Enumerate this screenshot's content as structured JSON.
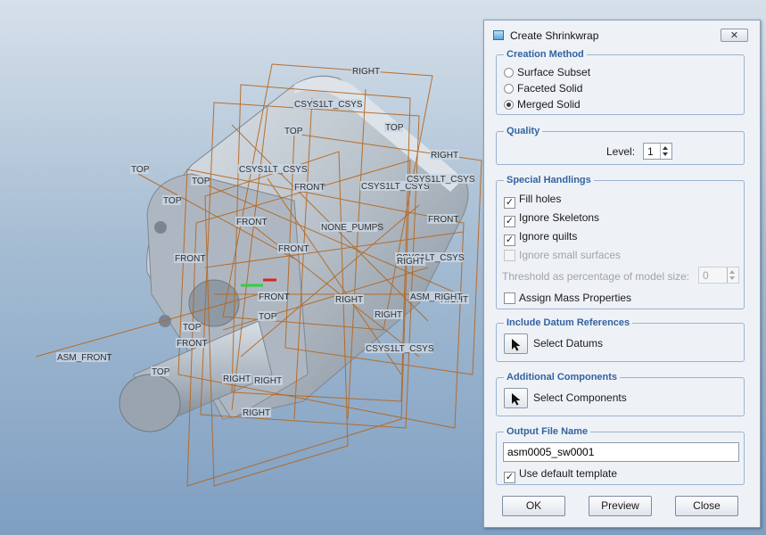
{
  "viewport": {
    "labels": [
      "RIGHT",
      "TOP",
      "TOP",
      "TOP",
      "FRONT",
      "FRONT",
      "ASM_FRONT",
      "TOP",
      "RIGHT",
      "RIGHT",
      "RIGHT",
      "RIGHT",
      "RIGHT",
      "TOP",
      "CSYS1LT_CSYS",
      "CSYS1LT_CSYS",
      "CSYS1LT_CSYS",
      "CSYS1LT_CSYS",
      "CSYS1LT_CSYS",
      "FRONT",
      "FRONT",
      "FRONT",
      "NONE_PUMPS",
      "ASM_RIGHT",
      "TOP",
      "RIGHT",
      "TOP",
      "CSYS1LT_CSYS",
      "RIGHT",
      "FRONT",
      "FRONT",
      "TOP",
      "RIGHT"
    ]
  },
  "dialog": {
    "title": "Create Shrinkwrap",
    "close_glyph": "✕",
    "creation_method": {
      "title": "Creation Method",
      "options": [
        "Surface Subset",
        "Faceted Solid",
        "Merged Solid"
      ],
      "selected": "Merged Solid"
    },
    "quality": {
      "title": "Quality",
      "level_label": "Level:",
      "level_value": "1"
    },
    "special_handlings": {
      "title": "Special Handlings",
      "fill_holes": "Fill holes",
      "ignore_skeletons": "Ignore Skeletons",
      "ignore_quilts": "Ignore quilts",
      "ignore_small_surfaces": "Ignore small surfaces",
      "threshold_label": "Threshold as percentage of model size:",
      "threshold_value": "0",
      "assign_mass": "Assign Mass Properties",
      "check_mark": "✓"
    },
    "datum_refs": {
      "title": "Include Datum References",
      "button_label": "Select Datums"
    },
    "components": {
      "title": "Additional Components",
      "button_label": "Select Components"
    },
    "output": {
      "title": "Output File Name",
      "file_name": "asm0005_sw0001",
      "default_template": "Use default template"
    },
    "buttons": {
      "ok": "OK",
      "preview": "Preview",
      "close": "Close"
    }
  },
  "colors": {
    "datum": "#b5651d",
    "group_title": "#3463a0",
    "part": "#c4ccd4"
  }
}
